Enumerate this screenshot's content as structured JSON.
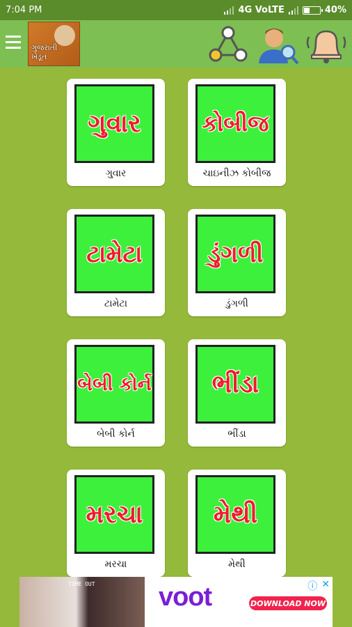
{
  "status_bar": {
    "time": "7:04 PM",
    "network": "4G VoLTE",
    "battery": "40%",
    "battery_level": 0.4
  },
  "app_bar": {
    "logo_text_line1": "ગુજરાતી",
    "logo_text_line2": "ખેડૂત",
    "icons": [
      "menu-icon",
      "share-icon",
      "profile-search-icon",
      "notification-bell-icon"
    ]
  },
  "colors": {
    "background": "#95b93a",
    "app_bar": "#7dbf52",
    "tile_green": "#3cf03c",
    "tile_text": "#ee1c2a",
    "ad_brand": "#7a1fd6",
    "ad_cta": "#f0244d"
  },
  "crops": [
    {
      "tile_text": "ગુવાર",
      "label": "ગુવાર",
      "size": 36
    },
    {
      "tile_text": "કોબીજ",
      "label": "ચાઇનીઝ કોબીજ",
      "size": 32
    },
    {
      "tile_text": "ટામેટા",
      "label": "ટામેટા",
      "size": 34
    },
    {
      "tile_text": "ડુંગળી",
      "label": "ડુંગળી",
      "size": 34
    },
    {
      "tile_text": "બેબી કોર્ન",
      "label": "બેબી કોર્ન",
      "size": 27
    },
    {
      "tile_text": "ભીંડા",
      "label": "ભીંડા",
      "size": 36
    },
    {
      "tile_text": "મરચા",
      "label": "મરચા",
      "size": 36
    },
    {
      "tile_text": "મેથી",
      "label": "મેથી",
      "size": 36
    }
  ],
  "ad": {
    "tag": "TIME OUT",
    "brand": "voot",
    "cta": "DOWNLOAD NOW",
    "info_icon": "ⓘ",
    "close_icon": "✕"
  }
}
